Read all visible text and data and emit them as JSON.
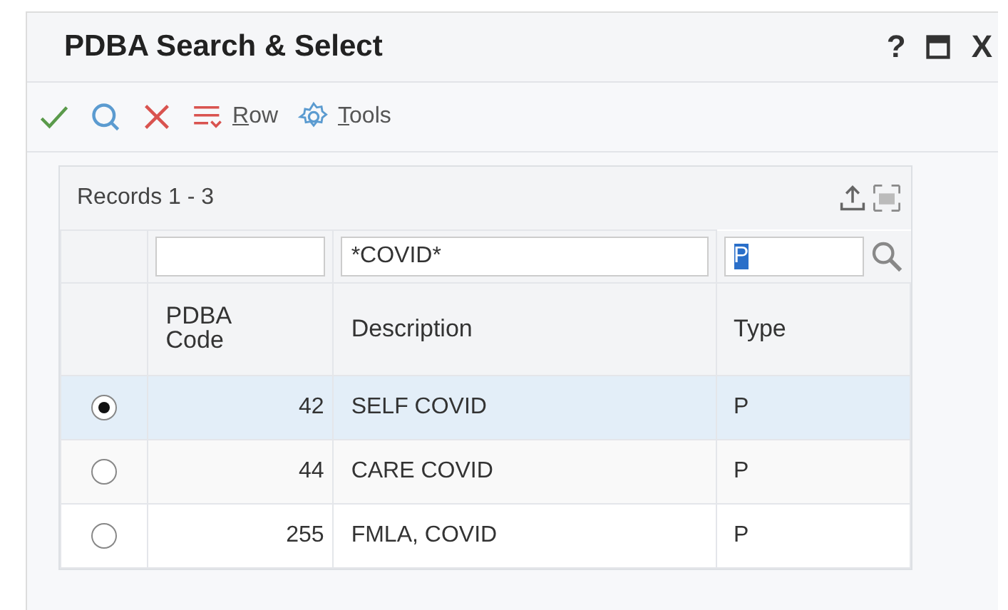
{
  "window": {
    "title": "PDBA Search & Select",
    "controls": [
      {
        "kind": "help",
        "label": "?"
      },
      {
        "kind": "maximize"
      },
      {
        "kind": "close",
        "label": "X"
      }
    ]
  },
  "toolbar": [
    {
      "kind": "check"
    },
    {
      "kind": "search"
    },
    {
      "kind": "cancel"
    },
    {
      "kind": "row",
      "label": "Row"
    },
    {
      "kind": "tools",
      "label": "Tools"
    }
  ],
  "grid": {
    "records": "Records 1 - 3",
    "filters": [
      {
        "kind": "text"
      },
      {
        "kind": "text",
        "value": "*COVID*"
      },
      {
        "kind": "text",
        "value": "P",
        "text_selected": true
      }
    ],
    "columns": [
      "PDBA Code",
      "Description",
      "Type"
    ],
    "rows": [
      {
        "selected": true,
        "cells": [
          "42",
          "SELF COVID",
          "P"
        ]
      },
      {
        "selected": false,
        "cells": [
          "44",
          "CARE COVID",
          "P"
        ]
      },
      {
        "selected": false,
        "cells": [
          "255",
          "FMLA, COVID",
          "P"
        ]
      }
    ]
  }
}
